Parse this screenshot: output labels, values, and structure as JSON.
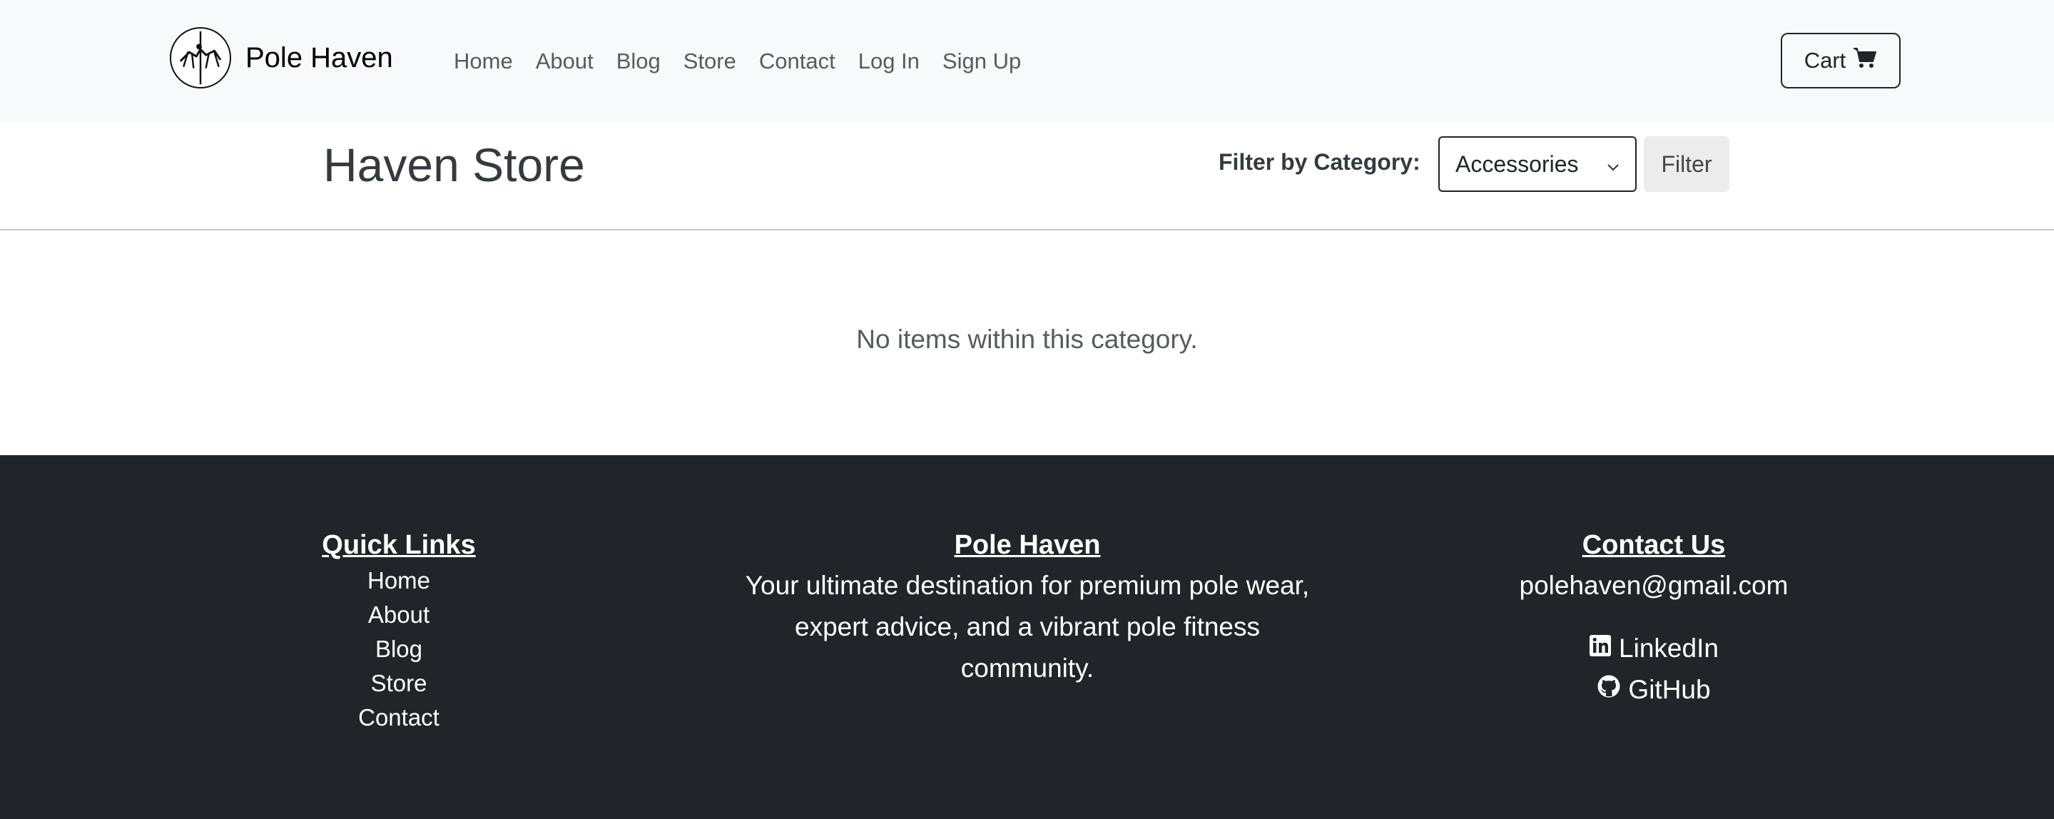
{
  "navbar": {
    "brand_name": "Pole Haven",
    "links": [
      "Home",
      "About",
      "Blog",
      "Store",
      "Contact",
      "Log In",
      "Sign Up"
    ],
    "cart_label": "Cart"
  },
  "store": {
    "title": "Haven Store",
    "filter_label": "Filter by Category:",
    "selected_category": "Accessories",
    "filter_button": "Filter",
    "empty_message": "No items within this category."
  },
  "footer": {
    "quick_links_heading": "Quick Links",
    "quick_links": [
      "Home",
      "About",
      "Blog",
      "Store",
      "Contact"
    ],
    "about_heading": "Pole Haven",
    "about_text": "Your ultimate destination for premium pole wear, expert advice, and a vibrant pole fitness community.",
    "contact_heading": "Contact Us",
    "email": "polehaven@gmail.com",
    "linkedin_label": "LinkedIn",
    "github_label": "GitHub"
  },
  "icons": {
    "brand": "pole-dancer-logo-icon",
    "cart": "shopping-cart-icon",
    "select": "chevron-down-icon",
    "linkedin": "linkedin-icon",
    "github": "github-icon"
  },
  "colors": {
    "navbar_bg": "#f8f9fa",
    "footer_bg": "#212529",
    "text_dark": "#212529",
    "muted": "#555b61"
  }
}
